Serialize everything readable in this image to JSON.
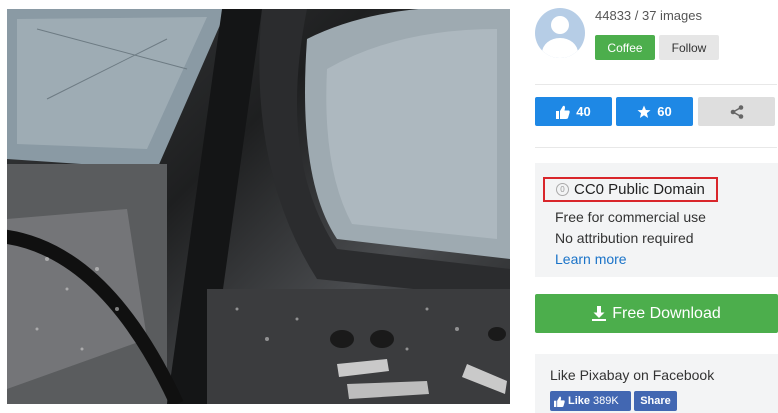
{
  "photo": {
    "alt_icon": "car-door-photo"
  },
  "user": {
    "stats": "44833 / 37 images",
    "coffee_label": "Coffee",
    "follow_label": "Follow"
  },
  "actions": {
    "likes": "40",
    "favorites": "60"
  },
  "license": {
    "title": "CC0 Public Domain",
    "cc_glyph": "0",
    "line1": "Free for commercial use",
    "line2": "No attribution required",
    "learn_more": "Learn more"
  },
  "download": {
    "label": "Free Download"
  },
  "facebook": {
    "text": "Like Pixabay on Facebook",
    "like_label": "Like",
    "like_count": "389K",
    "share_label": "Share"
  },
  "colors": {
    "green": "#4cae4c",
    "blue": "#1e88e5",
    "fb_blue": "#4267b2",
    "highlight": "#d9262b"
  }
}
